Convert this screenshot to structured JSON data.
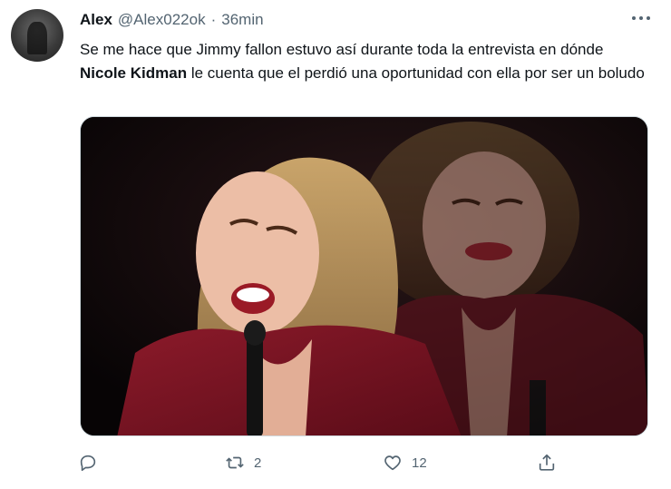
{
  "tweet": {
    "author_name": "Alex",
    "author_handle": "@Alex022ok",
    "separator": "·",
    "time": "36min",
    "text_part1": "Se me hace que Jimmy fallon estuvo así durante toda la entrevista en dónde",
    "text_bold": "Nicole Kidman",
    "text_part2": " le cuenta que el perdió una oportunidad con ella por ser un boludo"
  },
  "actions": {
    "reply_count": "",
    "retweet_count": "2",
    "like_count": "12"
  },
  "icons": {
    "more": "more-icon",
    "reply": "reply-icon",
    "retweet": "retweet-icon",
    "like": "like-icon",
    "share": "share-icon"
  },
  "colors": {
    "text": "#0f1419",
    "secondary": "#536471",
    "dress": "#7a1020"
  }
}
